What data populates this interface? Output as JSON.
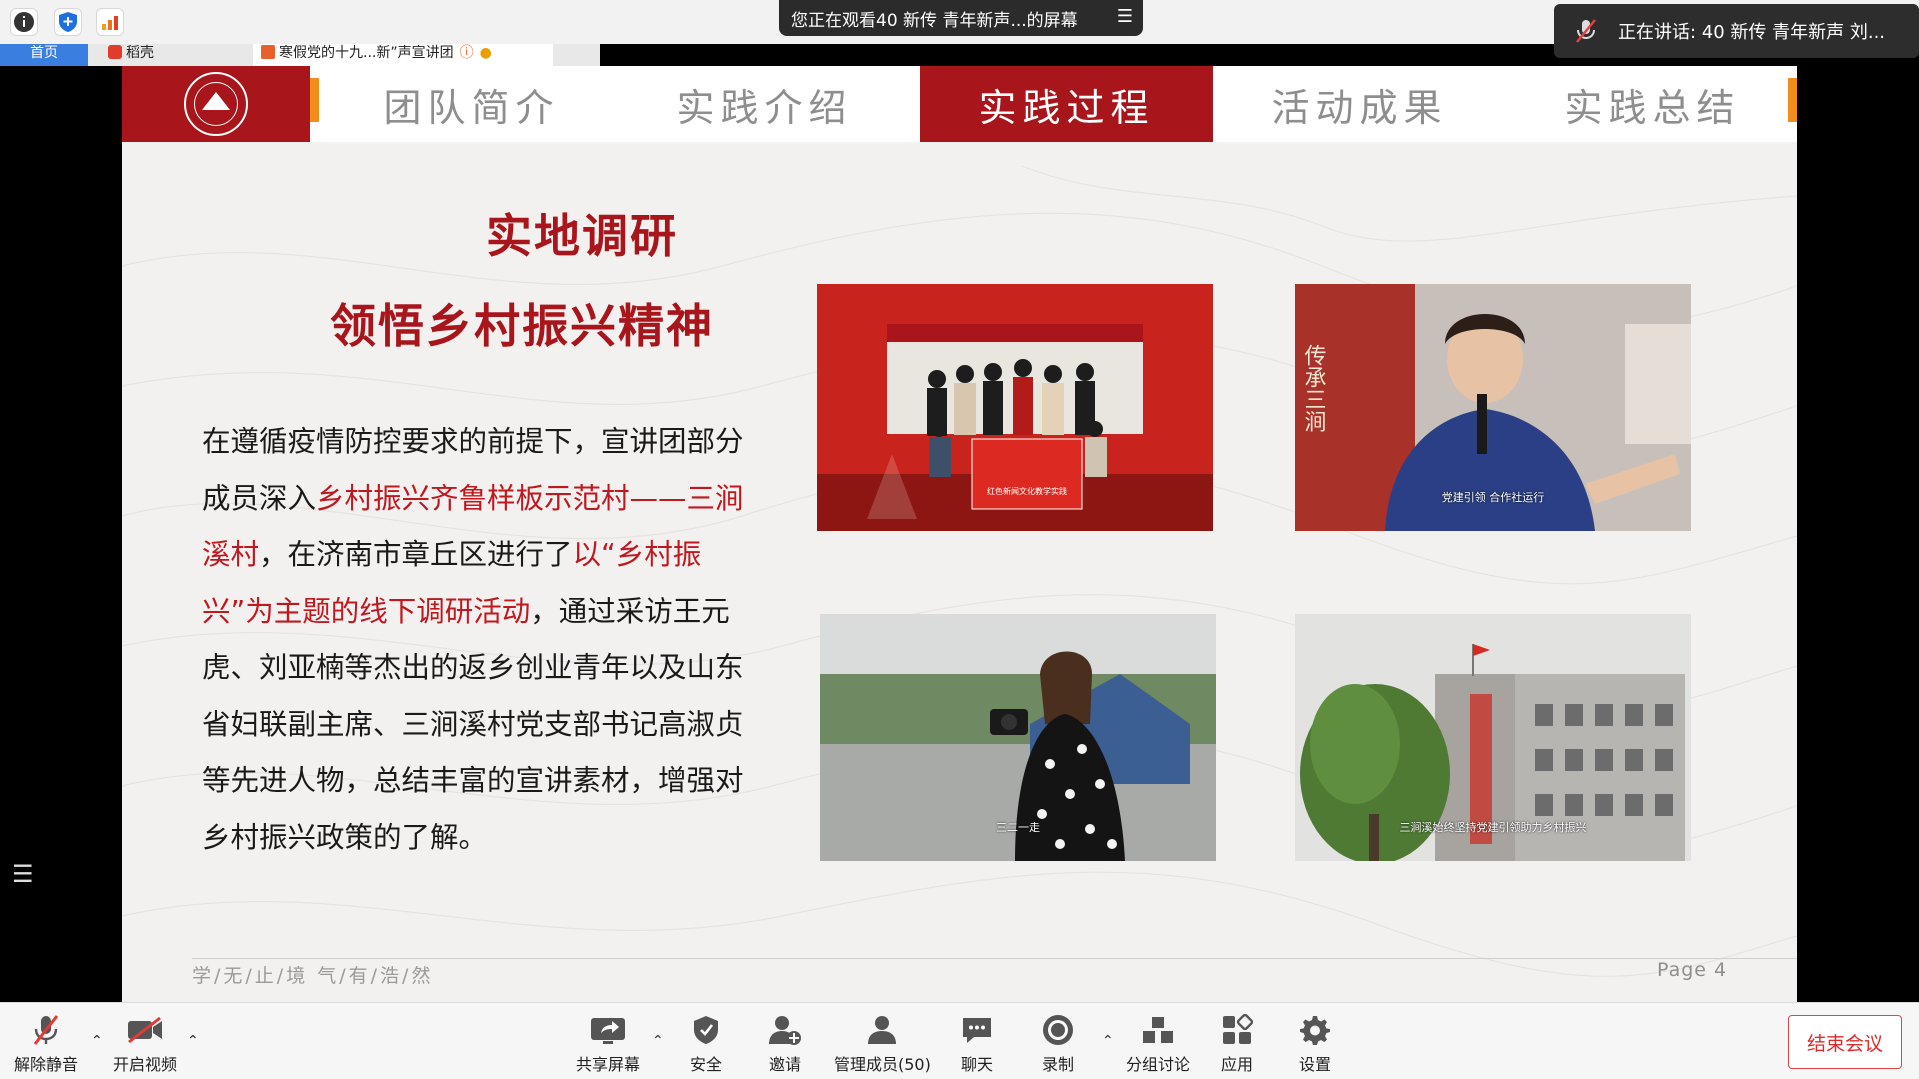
{
  "meeting": {
    "viewing_banner": "您正在观看40 新传 青年新声...的屏幕",
    "speaking_label": "正在讲话: 40 新传 青年新声 刘...",
    "end_button": "结束会议"
  },
  "browser_tabs": [
    {
      "label": "首页"
    },
    {
      "label": "稻壳"
    },
    {
      "label": "寒假党的十九...新”声宣讲团"
    }
  ],
  "slide": {
    "nav": [
      "团队简介",
      "实践介绍",
      "实践过程",
      "活动成果",
      "实践总结"
    ],
    "active_nav": "实践过程",
    "title_line1": "实地调研",
    "title_line2": "领悟乡村振兴精神",
    "body": {
      "p1": "在遵循疫情防控要求的前提下，宣讲团部分成员深入",
      "h1": "乡村振兴齐鲁样板示范村——三涧溪村",
      "p2": "，在济南市章丘区进行了",
      "h2": "以“乡村振兴”为主题的线下调研活动",
      "p3": "，通过采访王元虎、刘亚楠等杰出的返乡创业青年以及山东省妇联副主席、三涧溪村党支部书记高淑贞等先进人物，总结丰富的宣讲素材，增强对乡村振兴政策的了解。"
    },
    "photos": [
      {
        "caption": ""
      },
      {
        "caption": "党建引领  合作社运行"
      },
      {
        "caption": "三二一走"
      },
      {
        "caption": "三涧溪始终坚持党建引领助力乡村振兴"
      }
    ],
    "banner_text": "红色新闻文化教学实践",
    "wall_text": "传承三涧",
    "motto": "学/无/止/境  气/有/浩/然",
    "page_label": "Page 4"
  },
  "toolbar": {
    "unmute": "解除静音",
    "video": "开启视频",
    "share": "共享屏幕",
    "security": "安全",
    "invite": "邀请",
    "members": "管理成员(50)",
    "chat": "聊天",
    "record": "录制",
    "breakout": "分组讨论",
    "apps": "应用",
    "settings": "设置"
  },
  "colors": {
    "brand_red": "#a8151b",
    "highlight_red": "#c0181f",
    "accent_orange": "#f28c1a",
    "end_red": "#e02a2a"
  }
}
